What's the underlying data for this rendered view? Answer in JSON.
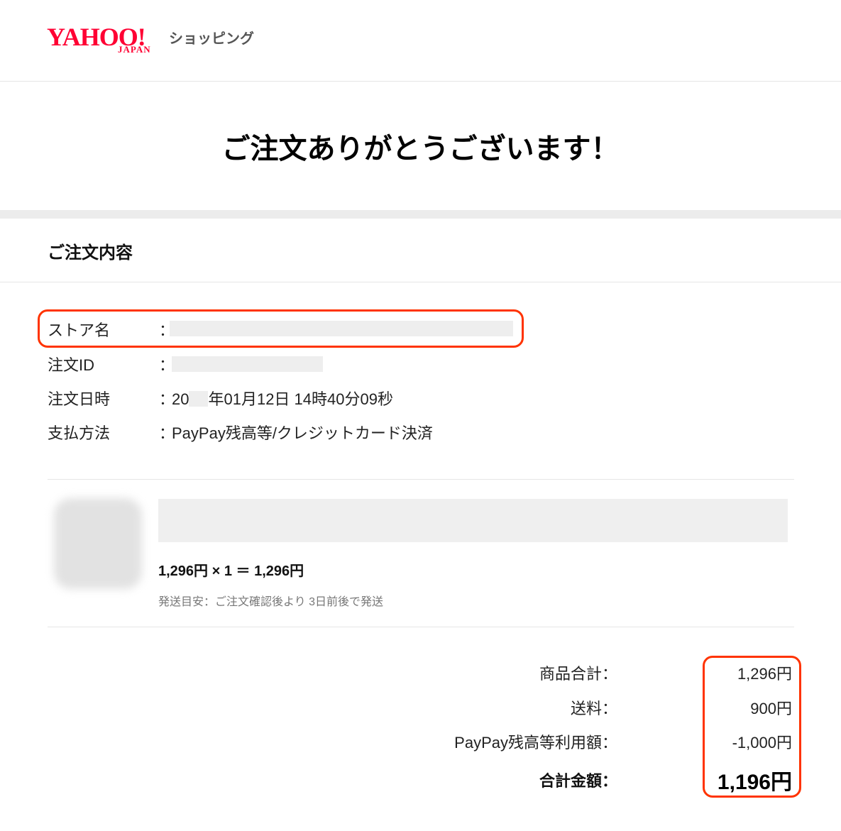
{
  "header": {
    "logo_yahoo": "YAHOO!",
    "logo_japan": "JAPAN",
    "logo_service": "ショッピング",
    "accent_color": "#ff0033"
  },
  "thanks_message": "ご注文ありがとうございます！",
  "order_section": {
    "title": "ご注文内容",
    "colon": "：",
    "rows": [
      {
        "label": "ストア名",
        "value": ""
      },
      {
        "label": "注文ID",
        "value": ""
      },
      {
        "label": "注文日時",
        "value_prefix": "20",
        "value_suffix": "年01月12日 14時40分09秒"
      },
      {
        "label": "支払方法",
        "value": "PayPay残高等/クレジットカード決済"
      }
    ]
  },
  "item": {
    "price_line": "1,296円 × 1 ＝ 1,296円",
    "shipping_note": "発送目安：ご注文確認後より 3日前後で発送"
  },
  "totals": {
    "rows": [
      {
        "label": "商品合計：",
        "value": "1,296円"
      },
      {
        "label": "送料：",
        "value": "900円"
      },
      {
        "label": "PayPay残高等利用額：",
        "value": "-1,000円"
      },
      {
        "label": "合計金額：",
        "value": "1,196円"
      }
    ]
  },
  "highlight_color": "#ff3300"
}
